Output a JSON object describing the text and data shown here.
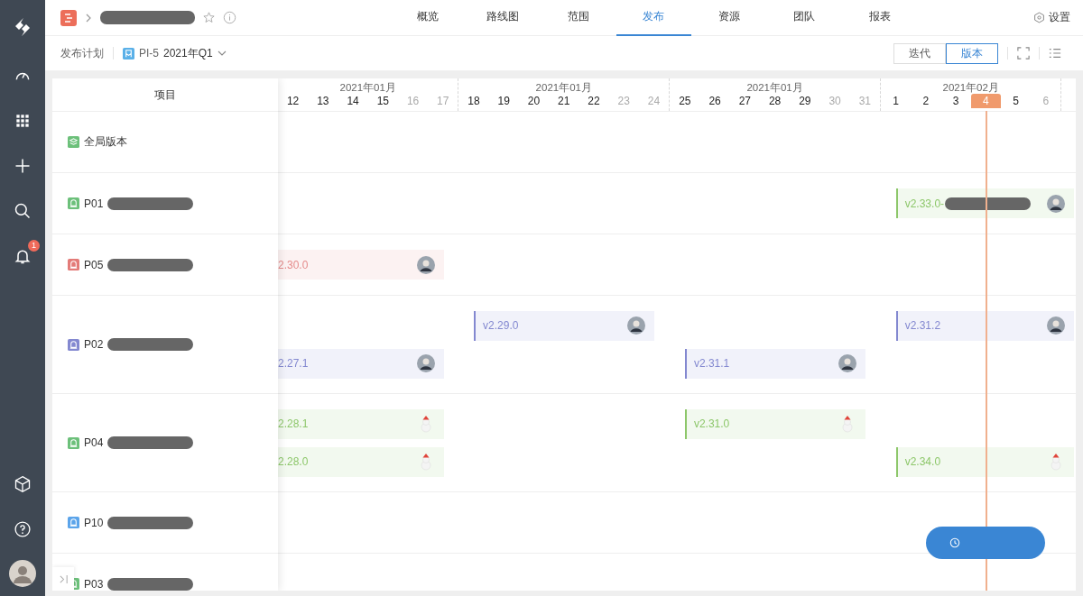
{
  "sidebar": {
    "notification_badge": "1"
  },
  "nav_tabs": [
    {
      "label": "概览",
      "selected": false
    },
    {
      "label": "路线图",
      "selected": false
    },
    {
      "label": "范围",
      "selected": false
    },
    {
      "label": "发布",
      "selected": true
    },
    {
      "label": "资源",
      "selected": false
    },
    {
      "label": "团队",
      "selected": false
    },
    {
      "label": "报表",
      "selected": false
    }
  ],
  "settings": "设置",
  "subheader": {
    "title": "发布计划",
    "pi": "PI-5",
    "quarter": "2021年Q1"
  },
  "view_toggle": [
    {
      "label": "迭代",
      "selected": false
    },
    {
      "label": "版本",
      "selected": true
    }
  ],
  "table": {
    "column_header": "项目"
  },
  "timeline": {
    "weeks": [
      {
        "month": "2021年01月",
        "days": [
          {
            "label": "12",
            "weekend": false,
            "today": false
          },
          {
            "label": "13",
            "weekend": false,
            "today": false
          },
          {
            "label": "14",
            "weekend": false,
            "today": false
          },
          {
            "label": "15",
            "weekend": false,
            "today": false
          },
          {
            "label": "16",
            "weekend": true,
            "today": false
          },
          {
            "label": "17",
            "weekend": true,
            "today": false
          }
        ]
      },
      {
        "month": "2021年01月",
        "days": [
          {
            "label": "18",
            "weekend": false,
            "today": false
          },
          {
            "label": "19",
            "weekend": false,
            "today": false
          },
          {
            "label": "20",
            "weekend": false,
            "today": false
          },
          {
            "label": "21",
            "weekend": false,
            "today": false
          },
          {
            "label": "22",
            "weekend": false,
            "today": false
          },
          {
            "label": "23",
            "weekend": true,
            "today": false
          },
          {
            "label": "24",
            "weekend": true,
            "today": false
          }
        ]
      },
      {
        "month": "2021年01月",
        "days": [
          {
            "label": "25",
            "weekend": false,
            "today": false
          },
          {
            "label": "26",
            "weekend": false,
            "today": false
          },
          {
            "label": "27",
            "weekend": false,
            "today": false
          },
          {
            "label": "28",
            "weekend": false,
            "today": false
          },
          {
            "label": "29",
            "weekend": false,
            "today": false
          },
          {
            "label": "30",
            "weekend": true,
            "today": false
          },
          {
            "label": "31",
            "weekend": true,
            "today": false
          }
        ]
      },
      {
        "month": "2021年02月",
        "days": [
          {
            "label": "1",
            "weekend": false,
            "today": false
          },
          {
            "label": "2",
            "weekend": false,
            "today": false
          },
          {
            "label": "3",
            "weekend": false,
            "today": false
          },
          {
            "label": "4",
            "weekend": false,
            "today": true
          },
          {
            "label": "5",
            "weekend": false,
            "today": false
          },
          {
            "label": "6",
            "weekend": true,
            "today": false
          }
        ]
      }
    ]
  },
  "rows": [
    {
      "name": "全局版本",
      "kind": "global",
      "color": "#6cc07a",
      "redacted": false,
      "lanes": []
    },
    {
      "name": "P01",
      "kind": "product",
      "color": "#6cc07a",
      "redacted": true,
      "lanes": [
        [
          {
            "kind": "empty"
          },
          {
            "kind": "empty"
          },
          {
            "kind": "empty"
          },
          {
            "kind": "release",
            "version": "v2.33.0-",
            "redacted": true,
            "color": "#8dc76a",
            "avatar": {
              "kind": "photo"
            }
          }
        ]
      ]
    },
    {
      "name": "P05",
      "kind": "product",
      "color": "#e37b78",
      "redacted": true,
      "lanes": [
        [
          {
            "kind": "release",
            "version": "2.30.0",
            "redacted": false,
            "color": "#e58b8b",
            "avatar": {
              "kind": "photo"
            }
          }
        ]
      ]
    },
    {
      "name": "P02",
      "kind": "product",
      "color": "#8388d0",
      "redacted": true,
      "lanes": [
        [
          {
            "kind": "empty"
          },
          {
            "kind": "release",
            "version": "v2.29.0",
            "redacted": false,
            "color": "#8388d0",
            "avatar": {
              "kind": "photo"
            }
          },
          {
            "kind": "empty"
          },
          {
            "kind": "release",
            "version": "v2.31.2",
            "redacted": false,
            "color": "#8388d0",
            "avatar": {
              "kind": "photo"
            }
          }
        ],
        [
          {
            "kind": "release",
            "version": "2.27.1",
            "redacted": false,
            "color": "#8388d0",
            "avatar": {
              "kind": "photo"
            }
          },
          {
            "kind": "empty"
          },
          {
            "kind": "release",
            "version": "v2.31.1",
            "redacted": false,
            "color": "#8388d0",
            "avatar": {
              "kind": "photo"
            }
          }
        ]
      ]
    },
    {
      "name": "P04",
      "kind": "product",
      "color": "#6cc07a",
      "redacted": true,
      "lanes": [
        [
          {
            "kind": "release",
            "version": "2.28.1",
            "redacted": false,
            "color": "#8dc76a",
            "avatar": {
              "kind": "snowman"
            }
          },
          {
            "kind": "empty"
          },
          {
            "kind": "release",
            "version": "v2.31.0",
            "redacted": false,
            "color": "#8dc76a",
            "avatar": {
              "kind": "snowman"
            }
          }
        ],
        [
          {
            "kind": "release",
            "version": "2.28.0",
            "redacted": false,
            "color": "#8dc76a",
            "avatar": {
              "kind": "snowman"
            }
          },
          {
            "kind": "empty"
          },
          {
            "kind": "empty"
          },
          {
            "kind": "release",
            "version": "v2.34.0",
            "redacted": false,
            "color": "#8dc76a",
            "avatar": {
              "kind": "snowman"
            }
          }
        ]
      ]
    },
    {
      "name": "P10",
      "kind": "product",
      "color": "#5ba4ea",
      "redacted": true,
      "lanes": []
    },
    {
      "name": "P03",
      "kind": "product",
      "color": "#6cc07a",
      "redacted": true,
      "lanes": []
    }
  ]
}
